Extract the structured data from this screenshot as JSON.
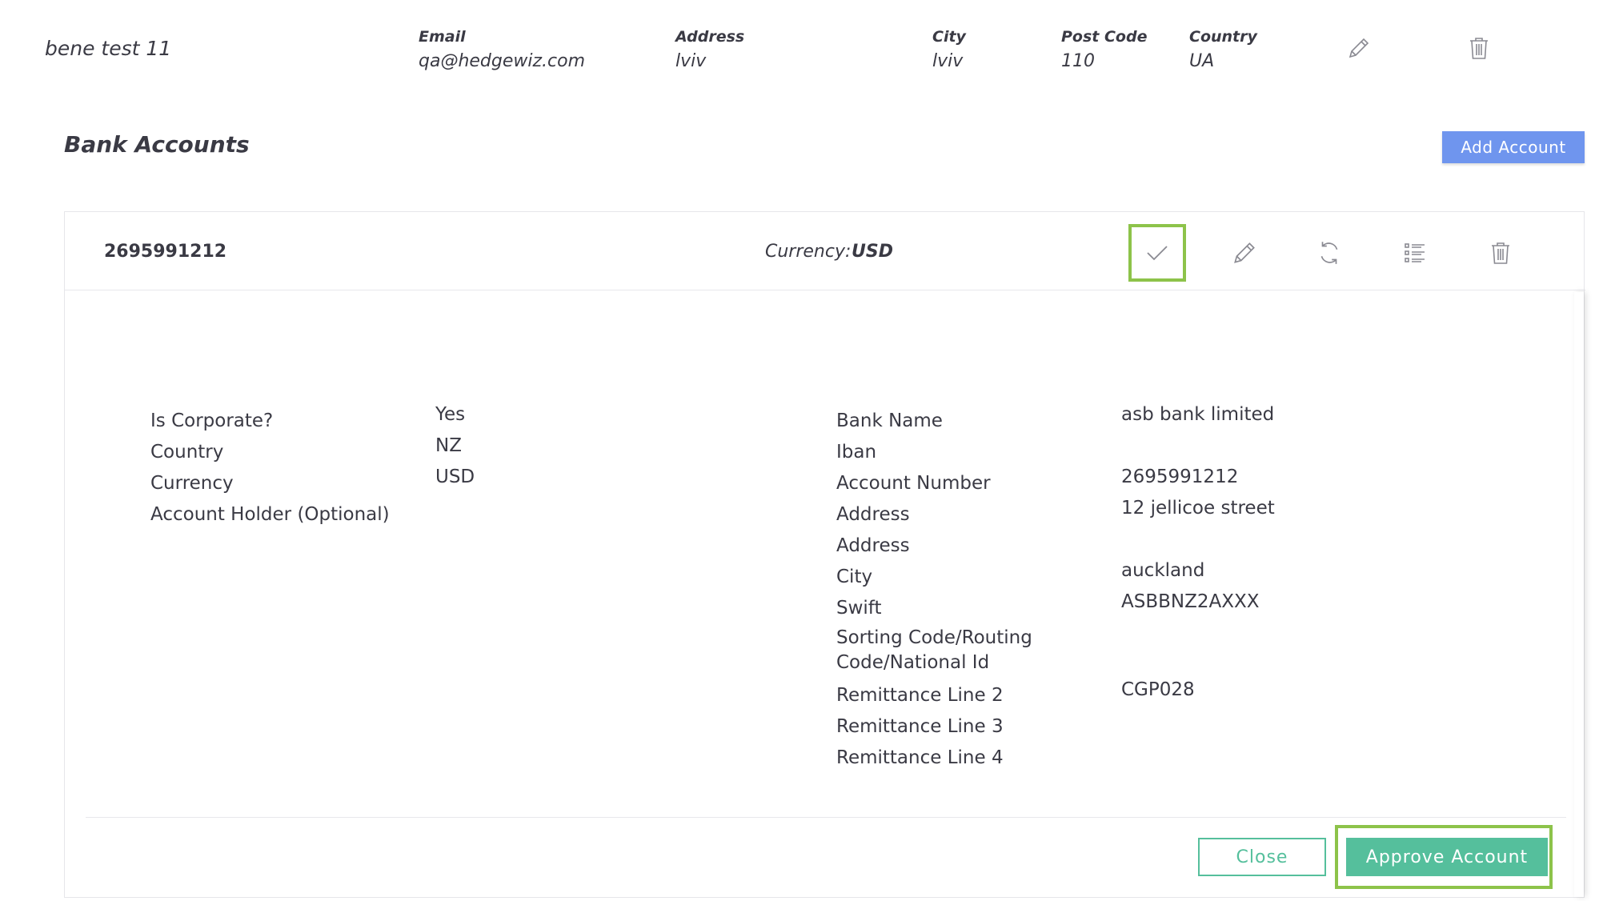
{
  "beneficiary": {
    "name": "bene test 11",
    "fields": [
      {
        "label": "Email",
        "value": "qa@hedgewiz.com"
      },
      {
        "label": "Address",
        "value": "lviv"
      },
      {
        "label": "City",
        "value": "lviv"
      },
      {
        "label": "Post Code",
        "value": "110"
      },
      {
        "label": "Country",
        "value": "UA"
      }
    ],
    "actions": {
      "edit_icon": "pencil-icon",
      "delete_icon": "trash-icon"
    }
  },
  "bank_accounts": {
    "title": "Bank Accounts",
    "add_label": "Add Account"
  },
  "account": {
    "number": "2695991212",
    "currency_label": "Currency:",
    "currency_value": "USD",
    "icons": [
      "check-icon",
      "pencil-icon",
      "refresh-icon",
      "list-icon",
      "trash-icon"
    ],
    "left_labels": [
      "Is Corporate?",
      "Country",
      "Currency",
      "Account Holder (Optional)"
    ],
    "left_values": [
      "Yes",
      "NZ",
      "USD"
    ],
    "right_labels": [
      "Bank Name",
      "Iban",
      "Account Number",
      "Address",
      "Address",
      "City",
      "Swift",
      "Sorting Code/Routing Code/National Id",
      "Remittance Line 2",
      "Remittance Line 3",
      "Remittance Line 4"
    ],
    "right_values": [
      "asb bank limited",
      "2695991212",
      "12 jellicoe street",
      "auckland",
      "ASBBNZ2AXXX",
      "CGP028"
    ]
  },
  "footer": {
    "close_label": "Close",
    "approve_label": "Approve Account"
  },
  "colors": {
    "primary_blue": "#6f95ee",
    "green": "#55bf9c",
    "highlight": "#8dc34a",
    "text": "#3a3a44"
  }
}
